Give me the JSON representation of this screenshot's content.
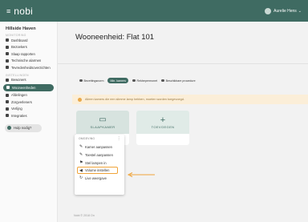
{
  "app": {
    "logo": "nobi",
    "menu_icon": "≡",
    "user_name": "Aurelie Hens",
    "user_chevron": "⌄"
  },
  "sidebar": {
    "org": "Hillside Haven",
    "section1": "MONITORING",
    "items1": [
      {
        "label": "Dashboard"
      },
      {
        "label": "Bezoekers"
      },
      {
        "label": "Slaap rapporten"
      },
      {
        "label": "Technische alarmen"
      },
      {
        "label": "Tevredenheidsoverzichten"
      }
    ],
    "section2": "INSTELLINGEN",
    "items2": [
      {
        "label": "Bewoners"
      },
      {
        "label": "Wooneenheden"
      },
      {
        "label": "Afdelingen"
      },
      {
        "label": "Zorgverleners"
      },
      {
        "label": "Verlijng"
      },
      {
        "label": "Integraties"
      }
    ],
    "help": "Hulp nodig?"
  },
  "main": {
    "title": "Wooneenheid: Flat 101",
    "filters": [
      "Bezettingsnorm",
      "Min. kamers",
      "Rekbepermonet",
      "Beschikbare procedure"
    ],
    "alert": "Alleen kamers die een slimme lamp hebben, moeten worden toegevoegd.",
    "cards": [
      {
        "label": "SLAAPKAMER",
        "icon": "▭"
      },
      {
        "label": "TOEVOEGEN",
        "icon": "+"
      }
    ],
    "dropdown": {
      "header": "OMGEVING",
      "kebab": "⋮",
      "items": [
        {
          "label": "Kamer aanpassen",
          "icon": "✎"
        },
        {
          "label": "Toestel aanpassen",
          "icon": "✎"
        },
        {
          "label": "Stel lampen in",
          "icon": "⚑"
        },
        {
          "label": "Volume instellen",
          "icon": "◀"
        },
        {
          "label": "Live weergave",
          "icon": "↻"
        }
      ]
    },
    "footer": "Nobi © 2018 On"
  },
  "colors": {
    "brand": "#3f6b62",
    "highlight": "#f0a43a",
    "alert_bg": "#fbeed8"
  }
}
